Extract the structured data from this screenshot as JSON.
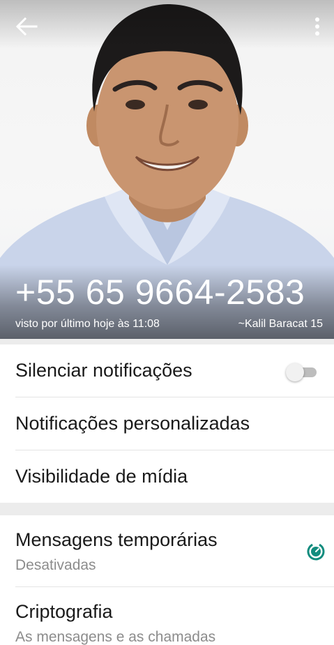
{
  "header": {
    "back_icon": "arrow-left-icon",
    "menu_icon": "more-vertical-icon",
    "phone_number": "+55 65 9664-2583",
    "last_seen": "visto por último hoje às 11:08",
    "push_name": "~Kalil Baracat 15"
  },
  "settings": {
    "mute_label": "Silenciar notificações",
    "mute_enabled": false,
    "custom_notifications_label": "Notificações personalizadas",
    "media_visibility_label": "Visibilidade de mídia",
    "disappearing_label": "Mensagens temporárias",
    "disappearing_value": "Desativadas",
    "disappearing_icon": "timer-icon",
    "encryption_label": "Criptografia",
    "encryption_desc": "As mensagens e as chamadas"
  },
  "colors": {
    "accent": "#128c7e",
    "text_primary": "#1a1a1a",
    "text_secondary": "#8c8c8c",
    "divider": "#ececec"
  }
}
